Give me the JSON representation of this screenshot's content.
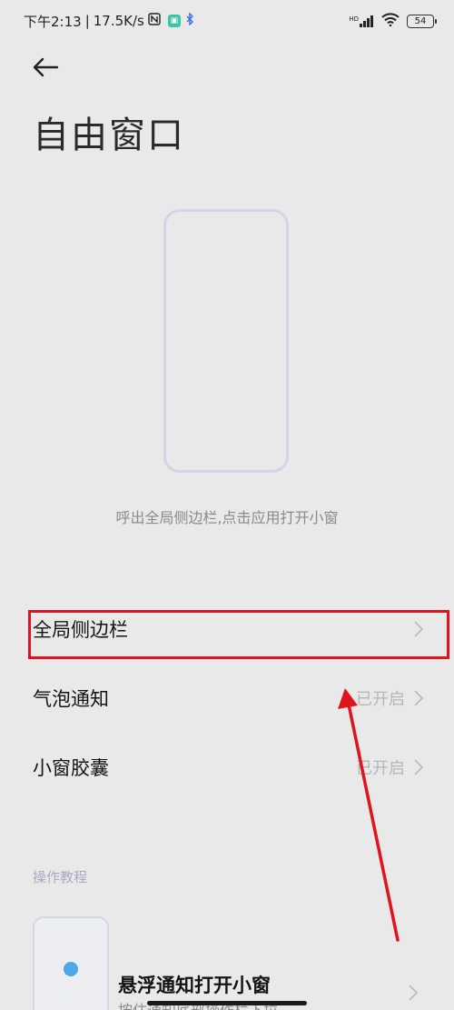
{
  "status_bar": {
    "time": "下午2:13",
    "net_speed": "17.5K/s",
    "network_type": "HD",
    "battery": "54",
    "icons": [
      "nfc-icon",
      "app-notification-icon",
      "bluetooth-icon",
      "signal-icon",
      "wifi-icon",
      "battery-icon"
    ]
  },
  "header": {
    "back_icon": "arrow-left-icon",
    "title": "自由窗口"
  },
  "illustration": {
    "caption": "呼出全局侧边栏,点击应用打开小窗"
  },
  "settings": [
    {
      "label": "全局侧边栏",
      "value": ""
    },
    {
      "label": "气泡通知",
      "value": "已开启"
    },
    {
      "label": "小窗胶囊",
      "value": "已开启"
    }
  ],
  "tutorial": {
    "section_header": "操作教程",
    "items": [
      {
        "title": "悬浮通知打开小窗",
        "subtitle": "按住通知底部操作栏下拉"
      }
    ]
  },
  "colors": {
    "background": "#e9e9e9",
    "highlight": "#e0141e",
    "accent_dot": "#4aa8ea"
  }
}
